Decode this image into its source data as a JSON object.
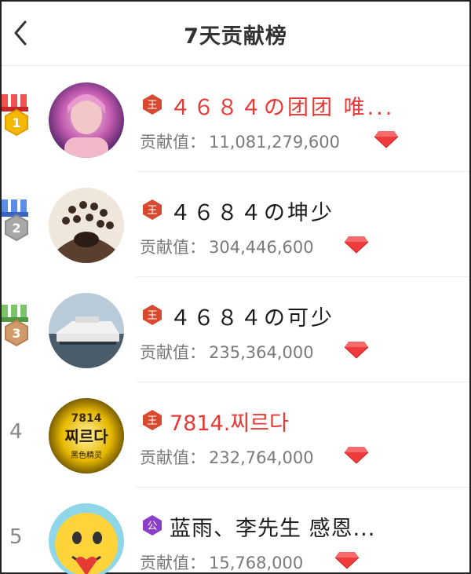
{
  "header": {
    "title": "7天贡献榜"
  },
  "contrib_label": "贡献值：",
  "rows": [
    {
      "rank": "1",
      "name": "４６８４の团团 唯...",
      "value": "11,081,279,600",
      "level_type": "王"
    },
    {
      "rank": "2",
      "name": "４６８４の坤少",
      "value": "304,446,600",
      "level_type": "王"
    },
    {
      "rank": "3",
      "name": "４６８４の可少",
      "value": "235,364,000",
      "level_type": "王"
    },
    {
      "rank": "4",
      "name": "7814.찌르다",
      "value": "232,764,000",
      "level_type": "王"
    },
    {
      "rank": "5",
      "name": "蓝雨、李先生 感恩...",
      "value": "15,768,000",
      "level_type": "公"
    }
  ],
  "avatar4_text": {
    "line1": "7814",
    "line2": "찌르다",
    "line3": "黑色精灵"
  },
  "colors": {
    "accent_red": "#e53935",
    "level_badge": "#d84a2f",
    "level_badge_purple": "#8b3fc9",
    "gem": "#ef3b3b"
  }
}
